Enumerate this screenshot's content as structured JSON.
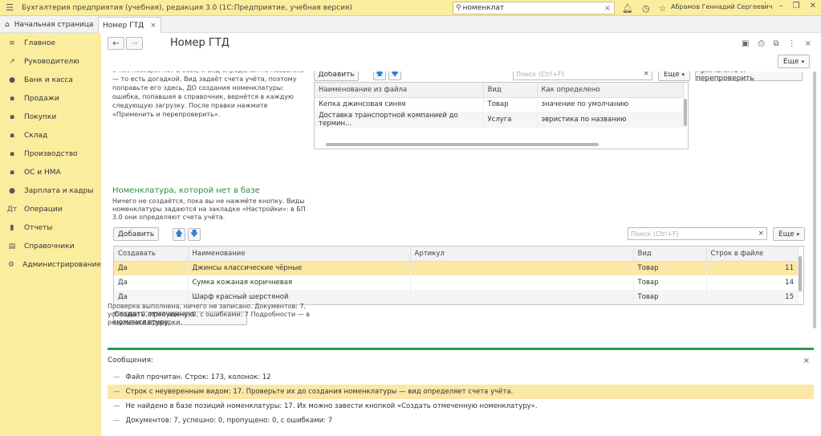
{
  "app": {
    "title": "Бухгалтерия предприятия (учебная), редакция 3.0  (1С:Предприятие, учебная версия)",
    "search_value": "номенклат",
    "user": "Абрамов Геннадий Сергеевич"
  },
  "tabs": {
    "home": "Начальная страница",
    "doc": "Номер ГТД"
  },
  "sidebar": {
    "items": [
      {
        "label": "Главное",
        "icon": "≡"
      },
      {
        "label": "Руководителю",
        "icon": "↗"
      },
      {
        "label": "Банк и касса",
        "icon": "●"
      },
      {
        "label": "Продажи",
        "icon": "▪"
      },
      {
        "label": "Покупки",
        "icon": "▪"
      },
      {
        "label": "Склад",
        "icon": "▪"
      },
      {
        "label": "Производство",
        "icon": "▪"
      },
      {
        "label": "ОС и НМА",
        "icon": "▪"
      },
      {
        "label": "Зарплата и кадры",
        "icon": "●"
      },
      {
        "label": "Операции",
        "icon": "Дт"
      },
      {
        "label": "Отчеты",
        "icon": "▮"
      },
      {
        "label": "Справочники",
        "icon": "▤"
      },
      {
        "label": "Администрирование",
        "icon": "⚙"
      }
    ]
  },
  "form": {
    "title": "Номер ГТД",
    "more_label": "Еще",
    "desc1": "с тих позиции нет в базе, и вид определён по названию — то есть догадкой. Вид задаёт счета учёта, поэтому поправьте его здесь, ДО создания номенклатуры: ошибка, попавшая в справочник, вернётся в каждую следующую загрузку. После правки нажмите «Применить и перепроверить».",
    "add_label": "Добавить",
    "search_placeholder": "Поиск (Ctrl+F)",
    "apply_label": "Применить и перепроверить",
    "top_table": {
      "headers": [
        "Наименование из файла",
        "Вид",
        "Как определено"
      ],
      "rows": [
        [
          "Кепка джинсовая синяя",
          "Товар",
          "значение по умолчанию"
        ],
        [
          "Доставка транспортной компанией до термин...",
          "Услуга",
          "эвристика по названию"
        ]
      ]
    },
    "section_title": "Номенклатура, которой нет в базе",
    "desc2": "Ничего не создаётся, пока вы не нажмёте кнопку. Виды номенклатуры задаются на закладке «Настройки»: в БП 3.0 они определяют счета учёта.",
    "bottom_table": {
      "headers": [
        "Создавать",
        "Наименование",
        "Артикул",
        "Вид",
        "Строк в файле"
      ],
      "rows": [
        [
          "Да",
          "Джинсы классические чёрные",
          "",
          "Товар",
          "11"
        ],
        [
          "Да",
          "Сумка кожаная коричневая",
          "",
          "Товар",
          "14"
        ],
        [
          "Да",
          "Шарф красный шерстяной",
          "",
          "Товар",
          "15"
        ]
      ]
    },
    "create_label": "Создать отмеченную номенклатуру",
    "result_text": "Проверка выполнена, ничего не записано. Документов: 7, успешно: 0, пропущено: 0, с ошибками: 7 Подробности — в результате проверки."
  },
  "messages": {
    "title": "Сообщения:",
    "items": [
      "Файл прочитан. Строк: 173, колонок: 12",
      "Строк с неуверенным видом: 17. Проверьте их до создания номенклатуры — вид определяет счета учёта.",
      "Не найдено в базе позиций номенклатуры: 17. Их можно завести кнопкой «Создать отмеченную номенклатуру».",
      "Документов: 7, успешно: 0, пропущено: 0, с ошибками: 7"
    ]
  },
  "colors": {
    "accent_yellow": "#fbed9e",
    "selected_row": "#fbe8a6",
    "section_green": "#2a8c3c",
    "message_line": "#2f9d4e"
  }
}
